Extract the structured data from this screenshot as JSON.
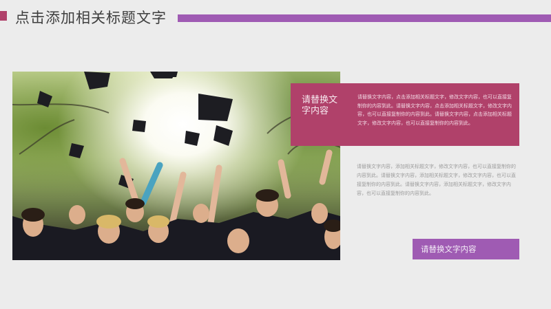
{
  "header": {
    "title": "点击添加相关标题文字"
  },
  "photo": {
    "description_icon": "graduation-photo"
  },
  "pink_box": {
    "title": "请替换文字内容",
    "text": "请替换文字内容，点击添加相关标题文字，修改文字内容，也可以直接复制你的内容到此。请替换文字内容，点击添加相关标题文字，修改文字内容，也可以直接复制你的内容到此。请替换文字内容，点击添加相关标题文字，修改文字内容，也可以直接复制你的内容到此。"
  },
  "grey_paragraph": {
    "text": "请替换文字内容，添加相关标题文字，修改文字内容，也可以直接复制你的内容到此。请替换文字内容，添加相关标题文字，修改文字内容，也可以直接复制你的内容到此。请替换文字内容，添加相关标题文字，修改文字内容，也可以直接复制你的内容到此。"
  },
  "button": {
    "label": "请替换文字内容"
  },
  "colors": {
    "accent_pink": "#b0416a",
    "accent_purple": "#9f5bb3",
    "background": "#ececec"
  }
}
